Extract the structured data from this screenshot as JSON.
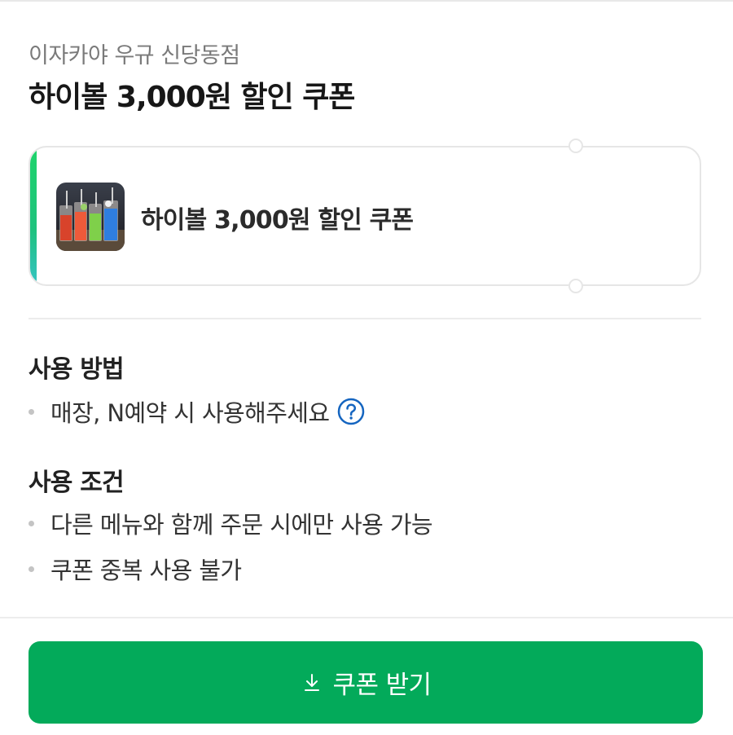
{
  "store": {
    "name": "이자카야 우규 신당동점"
  },
  "coupon": {
    "title": "하이볼 3,000원 할인 쿠폰",
    "card_label": "하이볼 3,000원 할인 쿠폰",
    "accent_color": "#1fd46b",
    "thumbnail_icon": "highball-drinks-photo"
  },
  "usage_method": {
    "title": "사용 방법",
    "items": [
      {
        "text": "매장, N예약 시 사용해주세요",
        "icon": "question-circle-icon"
      }
    ]
  },
  "usage_conditions": {
    "title": "사용 조건",
    "items": [
      {
        "text": "다른 메뉴와 함께 주문 시에만 사용 가능"
      },
      {
        "text": "쿠폰 중복 사용 불가"
      }
    ]
  },
  "action": {
    "download_label": "쿠폰 받기",
    "icon": "download-arrow-icon",
    "button_color": "#03aa5a"
  }
}
